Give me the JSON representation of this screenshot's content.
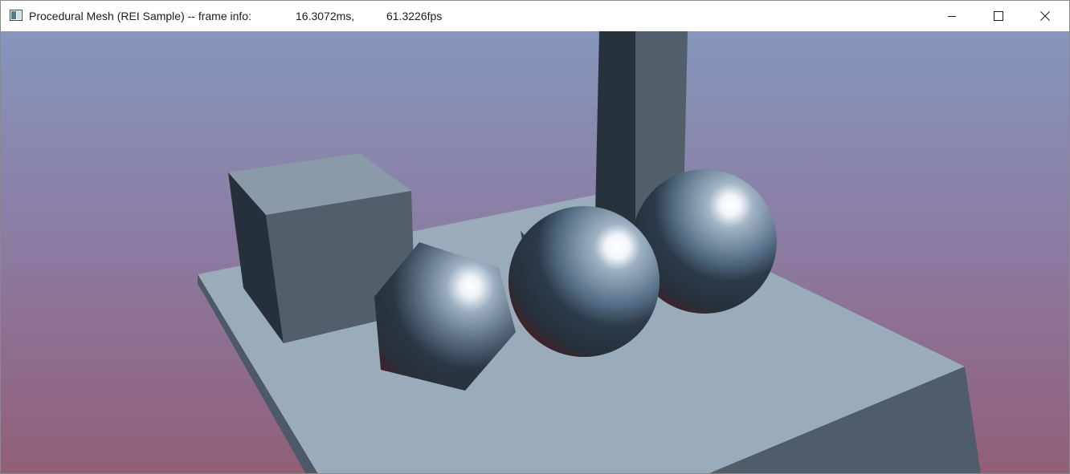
{
  "window": {
    "title": "Procedural Mesh (REI Sample) -- frame info:",
    "frame_ms": "16.3072ms,",
    "frame_fps": "61.3226fps",
    "controls": {
      "minimize_icon": "minimize-icon",
      "maximize_icon": "maximize-icon",
      "close_icon": "close-icon"
    }
  },
  "scene": {
    "sky_top_color": "#8696bd",
    "sky_bottom_color": "#915e77",
    "plane_color": "#9aabb9",
    "plane_side_color": "#4f5c69",
    "objects": [
      "plane",
      "pillar",
      "cube",
      "polyhedron-sphere",
      "sphere-front",
      "sphere-back"
    ]
  }
}
